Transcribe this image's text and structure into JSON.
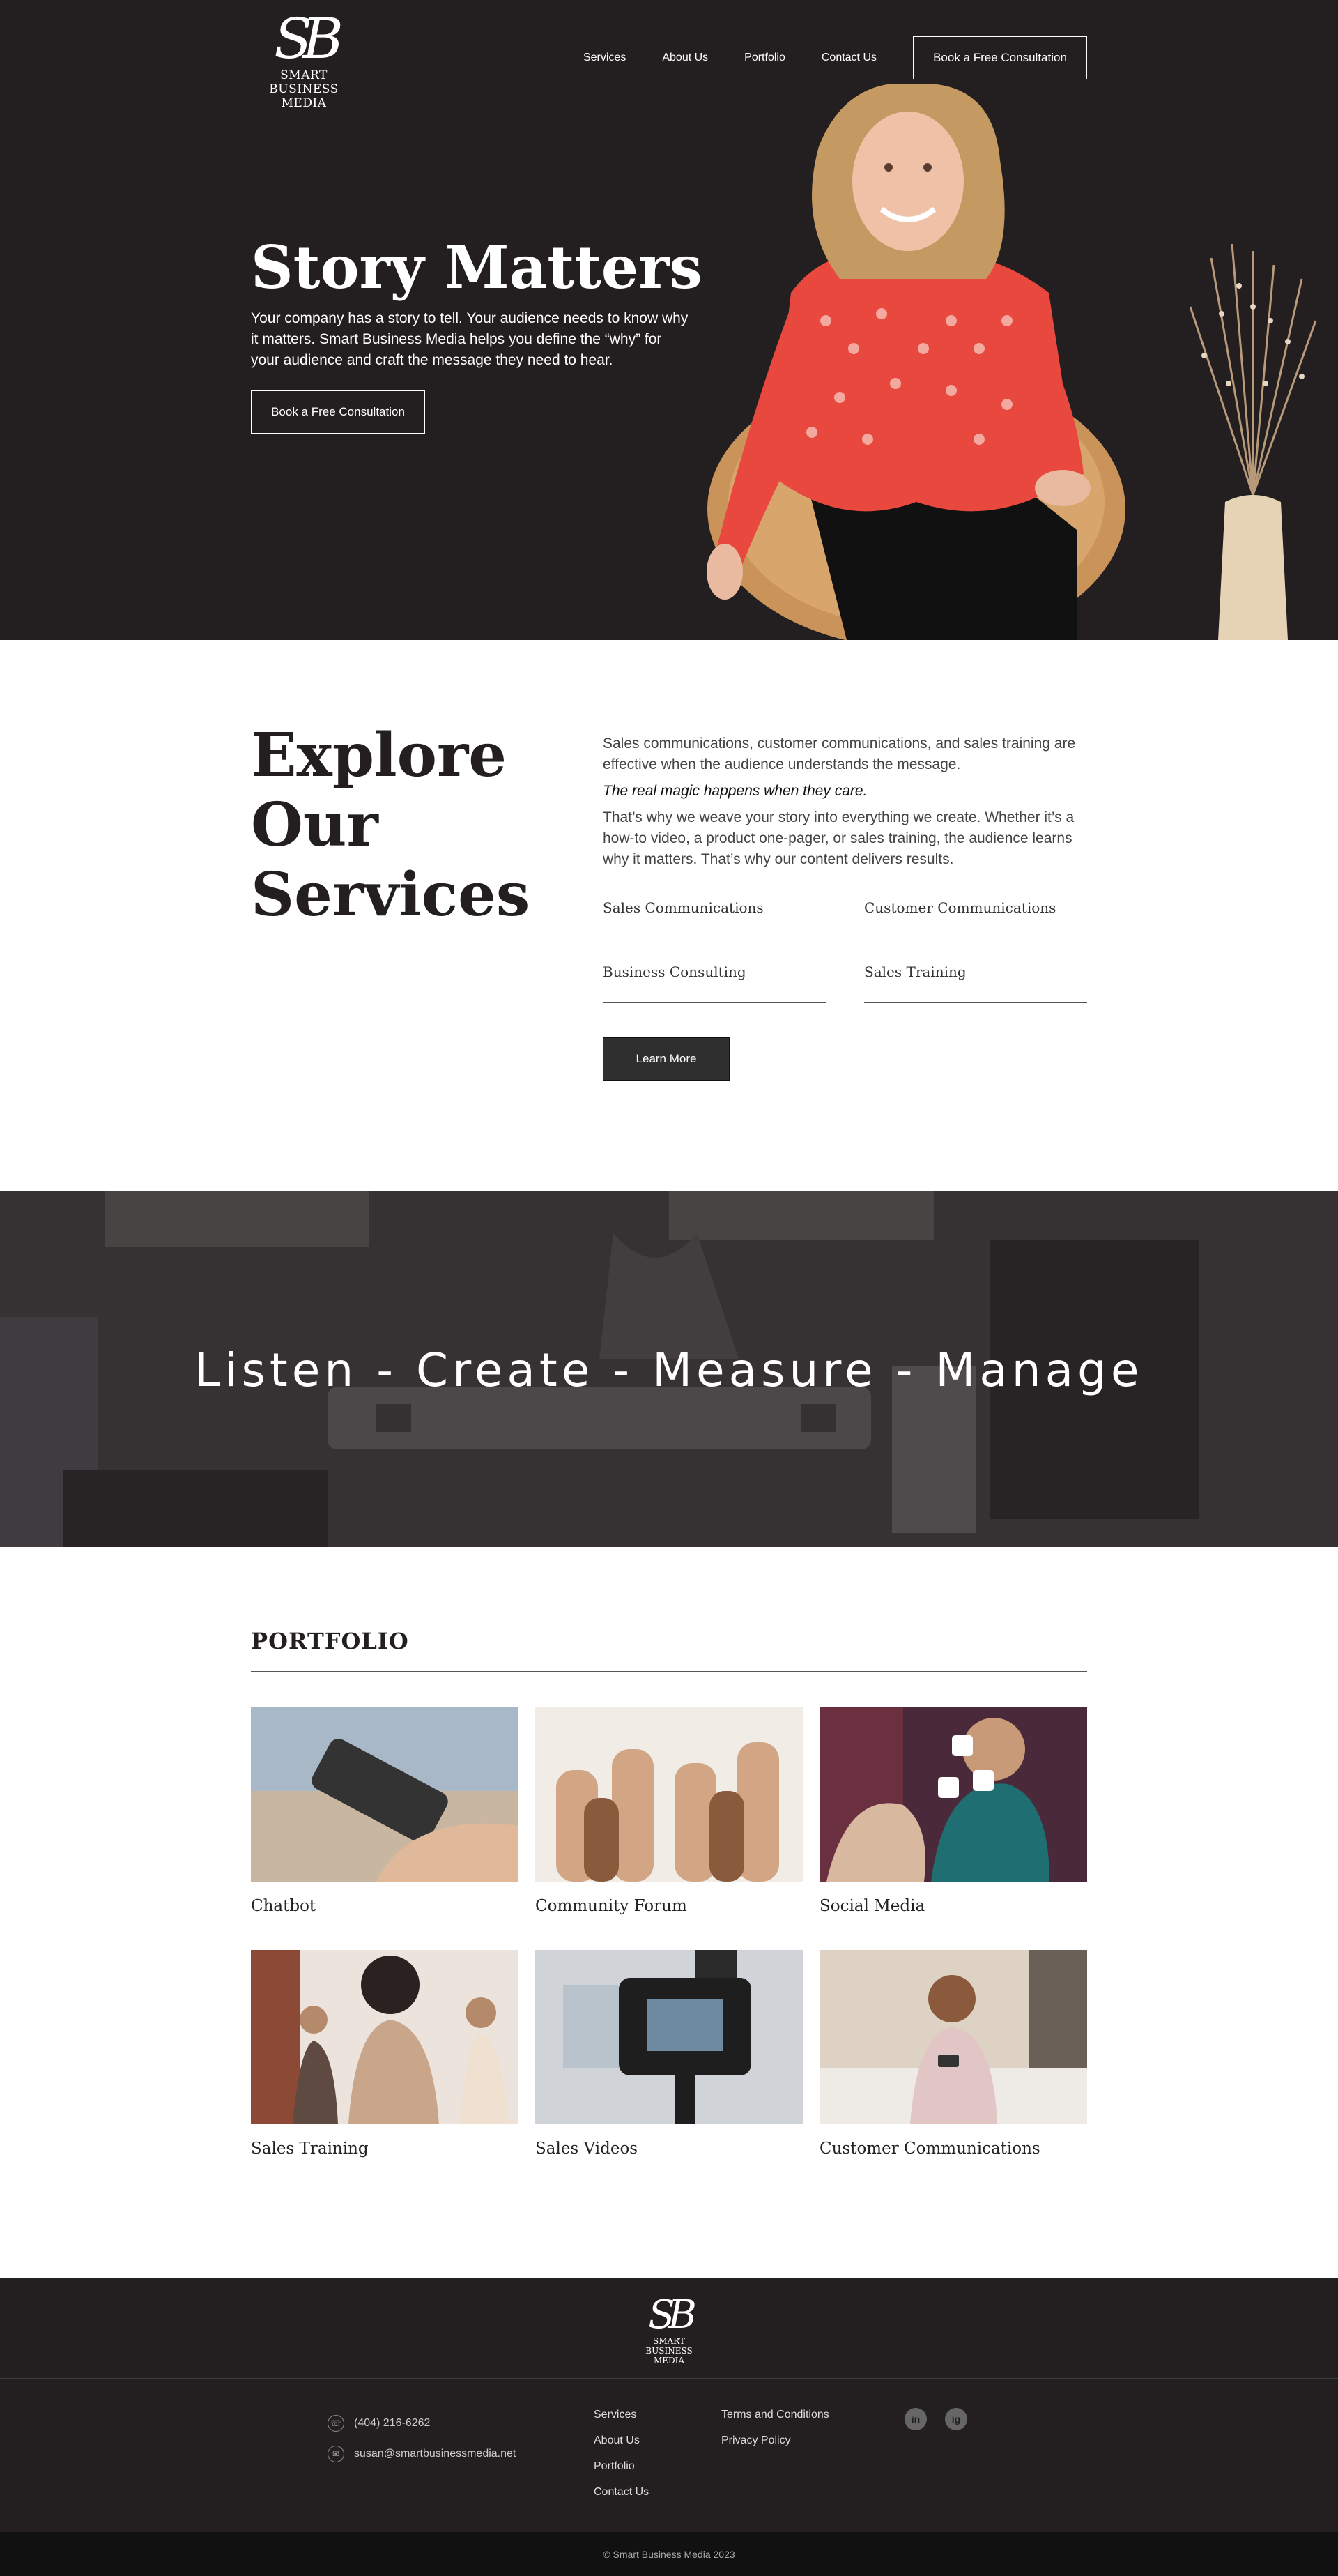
{
  "brand": {
    "mark": "SB",
    "name_line1": "SMART BUSINESS",
    "name_line2": "MEDIA"
  },
  "nav": {
    "items": [
      "Services",
      "About Us",
      "Portfolio",
      "Contact Us"
    ],
    "cta": "Book a Free Consultation"
  },
  "hero": {
    "title": "Story Matters",
    "text": "Your company has a story to tell. Your audience needs to know why it matters. Smart Business Media helps you define the “why” for your audience and craft the message they need to hear.",
    "cta": "Book a Free Consultation"
  },
  "services": {
    "title": "Explore Our Services",
    "intro": "Sales communications, customer communications, and sales training are effective when the audience understands the message.",
    "magic": "The real magic happens when they care.",
    "body": "That’s why we weave your story into everything we create. Whether it’s a how-to video, a product one-pager, or sales training, the audience learns why it matters. That’s why our content delivers results.",
    "items": [
      "Sales Communications",
      "Customer Communications",
      "Business Consulting",
      "Sales Training"
    ],
    "learn_more": "Learn More"
  },
  "banner": {
    "text": "Listen - Create - Measure - Manage"
  },
  "portfolio": {
    "title": "PORTFOLIO",
    "items": [
      "Chatbot",
      "Community Forum",
      "Social Media",
      "Sales Training",
      "Sales Videos",
      "Customer Communications"
    ]
  },
  "footer": {
    "phone": "(404) 216-6262",
    "email": "susan@smartbusinessmedia.net",
    "links": [
      "Services",
      "About Us",
      "Portfolio",
      "Contact Us"
    ],
    "legal": [
      "Terms and Conditions",
      "Privacy Policy"
    ],
    "social": [
      "in",
      "ig"
    ],
    "copyright": "© Smart Business Media 2023"
  },
  "colors": {
    "dark": "#231f20",
    "accent_red": "#e8483e",
    "footer_bottom": "#111111"
  }
}
